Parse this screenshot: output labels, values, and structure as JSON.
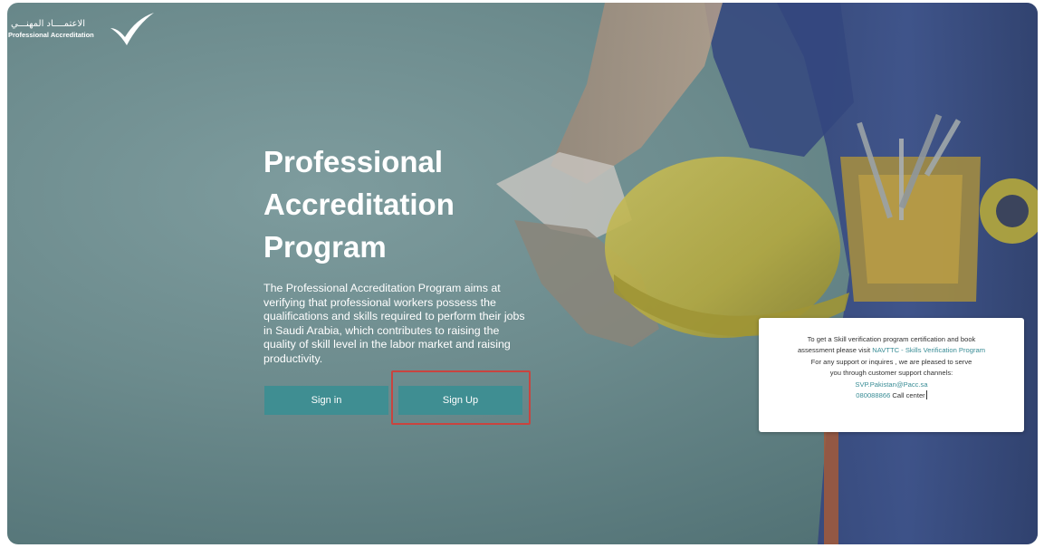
{
  "logo": {
    "arabic_name": "الاعتمــــاد المهنـــي",
    "english_name": "Professional Accreditation"
  },
  "hero": {
    "title": "Professional Accreditation Program",
    "description": "The Professional Accreditation Program aims at verifying that professional workers possess the qualifications and skills required to perform their jobs in Saudi Arabia, which contributes to raising the quality of skill level in the labor market and raising productivity.",
    "signin_label": "Sign in",
    "signup_label": "Sign Up"
  },
  "info_card": {
    "line1": "To get a Skill verification program certification and book",
    "line2_prefix": "assessment please visit ",
    "line2_link": "NAVTTC - Skills Verification Program",
    "line3": "For any support or inquires , we are pleased to serve",
    "line4": "you through customer support channels:",
    "email": "SVP.Pakistan@Pacc.sa",
    "phone": "080088866",
    "phone_suffix": " Call center"
  },
  "colors": {
    "background": "#6c8b8d",
    "button": "#3f8e92",
    "highlight": "#c9443f",
    "link": "#3a8d96",
    "helmet": "#b8ad4a",
    "coverall": "#33457f"
  },
  "icons": {
    "logo_mark": "checkmark-logo-icon"
  }
}
